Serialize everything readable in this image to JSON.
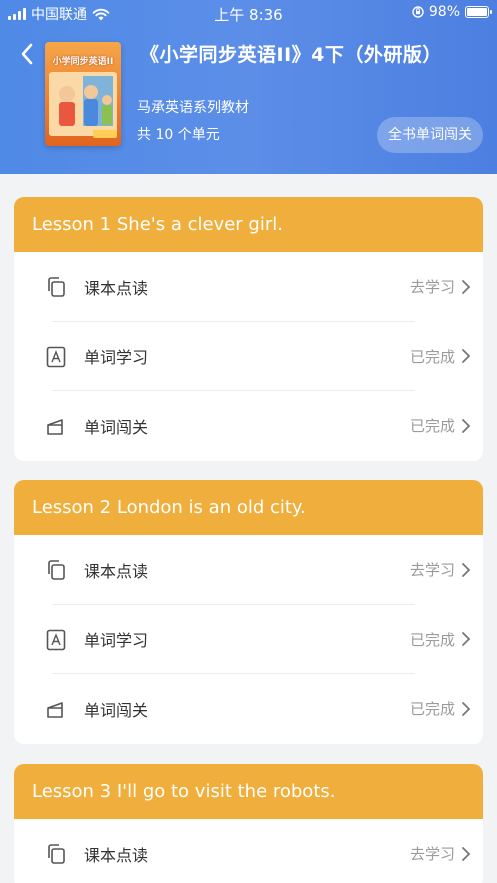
{
  "status_bar": {
    "carrier": "中国联通",
    "time": "上午 8:36",
    "battery": "98%",
    "battery_level": 0.98
  },
  "header": {
    "title": "《小学同步英语II》4下（外研版）",
    "subtitle": "马承英语系列教材",
    "unit_count": "共 10 个单元",
    "pass_button": "全书单词闯关"
  },
  "cover": {
    "title_text": "小学同步英语II"
  },
  "lessons": [
    {
      "title": "Lesson 1 She's a clever girl.",
      "rows": [
        {
          "label": "课本点读",
          "status": "去学习",
          "icon": "copy-icon"
        },
        {
          "label": "单词学习",
          "status": "已完成",
          "icon": "letter-a-icon"
        },
        {
          "label": "单词闯关",
          "status": "已完成",
          "icon": "flag-icon"
        }
      ]
    },
    {
      "title": "Lesson 2 London is an old city.",
      "rows": [
        {
          "label": "课本点读",
          "status": "去学习",
          "icon": "copy-icon"
        },
        {
          "label": "单词学习",
          "status": "已完成",
          "icon": "letter-a-icon"
        },
        {
          "label": "单词闯关",
          "status": "已完成",
          "icon": "flag-icon"
        }
      ]
    },
    {
      "title": "Lesson 3 I'll go to visit the robots.",
      "rows": [
        {
          "label": "课本点读",
          "status": "去学习",
          "icon": "copy-icon"
        }
      ]
    }
  ],
  "colors": {
    "header_blue": "#5c8ee8",
    "lesson_orange": "#f0ae3c"
  }
}
